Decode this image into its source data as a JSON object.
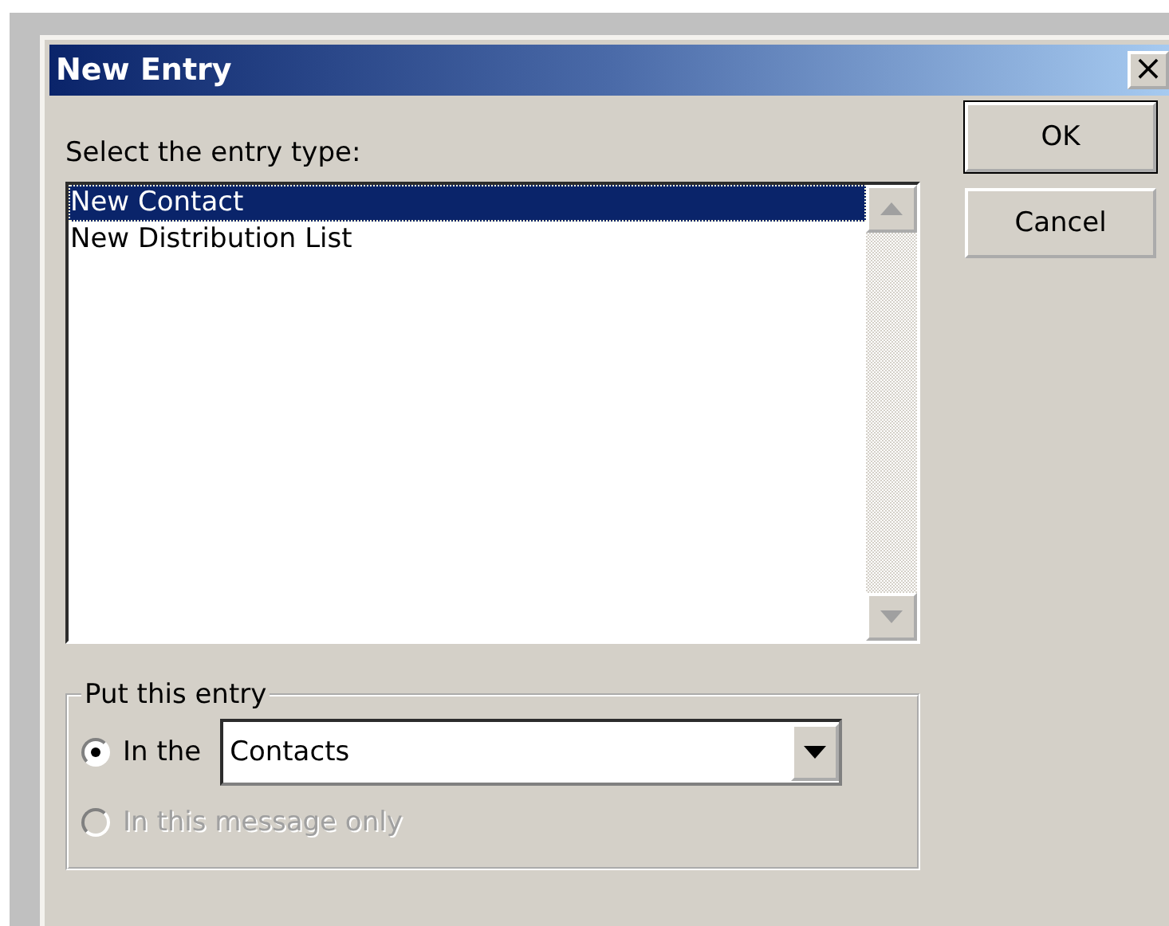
{
  "window": {
    "title": "New Entry",
    "close": "×"
  },
  "prompt": "Select the entry type:",
  "entry_types": [
    {
      "label": "New Contact",
      "selected": true
    },
    {
      "label": "New Distribution List",
      "selected": false
    }
  ],
  "buttons": [
    "OK",
    "Cancel"
  ],
  "group": {
    "legend": "Put this entry",
    "options": [
      {
        "kind": "folder",
        "label": "In the",
        "checked": true,
        "disabled": false,
        "value": "Contacts"
      },
      {
        "kind": "plain",
        "label": "In this message only",
        "checked": false,
        "disabled": true
      }
    ]
  }
}
